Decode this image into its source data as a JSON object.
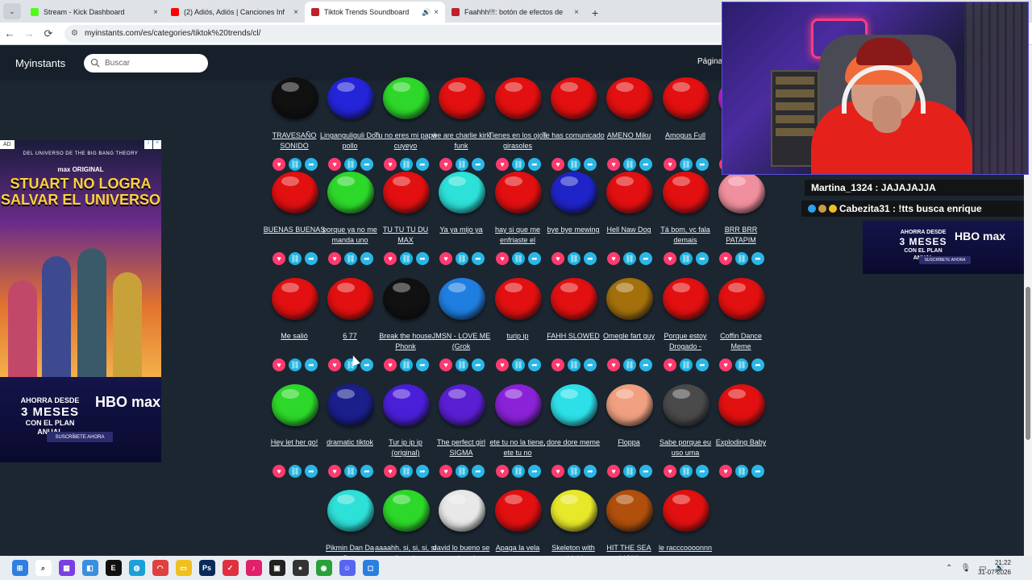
{
  "browser": {
    "tabs": [
      {
        "title": "Stream - Kick Dashboard",
        "color": "#53fc18",
        "active": false,
        "audio": false
      },
      {
        "title": "(2) Adiós, Adiós | Canciones Inf",
        "color": "#ff0000",
        "active": false,
        "audio": false
      },
      {
        "title": "Tiktok Trends Soundboard",
        "color": "#c0202a",
        "active": true,
        "audio": true
      },
      {
        "title": "Faahhh!!!: botón de efectos de",
        "color": "#c0202a",
        "active": false,
        "audio": false
      }
    ],
    "url": "myinstants.com/es/categories/tiktok%20trends/cl/"
  },
  "site": {
    "logo": "Myinstants",
    "search_placeholder": "Buscar",
    "header_right": "Página"
  },
  "buttons": [
    {
      "label": "TRAVESAÑO SONIDO",
      "color": "#111111"
    },
    {
      "label": "Linganguliguli Don pollo",
      "color": "#2424d8"
    },
    {
      "label": "Tu no eres mi papá cuyeyo",
      "color": "#2ed82a"
    },
    {
      "label": "we are charlie kirk funk",
      "color": "#e21010"
    },
    {
      "label": "Tienes en los ojos girasoles",
      "color": "#e21010"
    },
    {
      "label": "Te has comunicado",
      "color": "#e21010"
    },
    {
      "label": "AMENO Miku",
      "color": "#e21010"
    },
    {
      "label": "Amogus Full",
      "color": "#e21010"
    },
    {
      "label": "",
      "color": "#c21fd2"
    },
    {
      "label": "BUENAS BUENAS",
      "color": "#e21010"
    },
    {
      "label": "porque ya no me manda uno",
      "color": "#2ed82a"
    },
    {
      "label": "TU TU TU DU MAX",
      "color": "#e21010"
    },
    {
      "label": "Ya ya mijo ya",
      "color": "#2de0d8"
    },
    {
      "label": "hay si que me enfriaste el",
      "color": "#e21010"
    },
    {
      "label": "bye bye mewing",
      "color": "#1f24c8"
    },
    {
      "label": "Hell Naw Dog",
      "color": "#e21010"
    },
    {
      "label": "Tá bom, vc fala demais",
      "color": "#e21010"
    },
    {
      "label": "BRR BRR PATAPIM",
      "color": "#f08f9e"
    },
    {
      "label": "Me salió",
      "color": "#e21010"
    },
    {
      "label": "6 77",
      "color": "#e21010"
    },
    {
      "label": "Break the house Phonk",
      "color": "#111111"
    },
    {
      "label": "JMSN - LOVE ME (Grok",
      "color": "#1f7fe0"
    },
    {
      "label": "turip ip",
      "color": "#e21010"
    },
    {
      "label": "FAHH SLOWED",
      "color": "#e21010"
    },
    {
      "label": "Omegle fart guy",
      "color": "#a3700c"
    },
    {
      "label": "Porque estoy Drogado -",
      "color": "#e21010"
    },
    {
      "label": "Coffin Dance Meme",
      "color": "#e21010"
    },
    {
      "label": "Hey let her go!",
      "color": "#2ed82a"
    },
    {
      "label": "dramatic tiktok",
      "color": "#1a1f8c"
    },
    {
      "label": "Tur ip ip ip (original)",
      "color": "#4a1fd8"
    },
    {
      "label": "The perfect girl SIGMA",
      "color": "#5a1fd2"
    },
    {
      "label": "ete tu no la tiene, ete tu no",
      "color": "#8a22d8"
    },
    {
      "label": "dore dore meme",
      "color": "#2de0e8"
    },
    {
      "label": "Floppa",
      "color": "#f0a080"
    },
    {
      "label": "Sabe porque eu uso uma",
      "color": "#4a4a4a"
    },
    {
      "label": "Exploding Baby",
      "color": "#e21010"
    },
    {
      "label": "Pikmin Dan Da Dan",
      "color": "#2de0d8"
    },
    {
      "label": "aaaahh. si, si, si, si di mario",
      "color": "#2ed82a"
    },
    {
      "label": "david lo bueno se queda solo",
      "color": "#e8e8e8"
    },
    {
      "label": "Apaga la vela",
      "color": "#e21010"
    },
    {
      "label": "Skeleton with shield",
      "color": "#e8e82a"
    },
    {
      "label": "HIT THE SEA LION!",
      "color": "#b0500c"
    },
    {
      "label": "le racccoooonnn",
      "color": "#e21010"
    }
  ],
  "ads": {
    "tag": "AD",
    "supertitle": "DEL UNIVERSO DE THE BIG BANG THEORY",
    "brand": "max ORIGINAL",
    "title": "STUART NO LOGRA SALVAR EL UNIVERSO",
    "save_line1": "AHORRA DESDE",
    "save_line2": "3 MESES",
    "save_line3": "CON EL PLAN ANUAL",
    "logo": "HBO max",
    "cta": "SUSCRÍBETE AHORA"
  },
  "chat": [
    {
      "user": "Martina_1324",
      "message": "JAJAJAJJA"
    },
    {
      "user": "Cabezita31",
      "message": "!tts busca enrique"
    }
  ],
  "taskbar": {
    "time": "21:22",
    "date": "31-07-2026"
  }
}
